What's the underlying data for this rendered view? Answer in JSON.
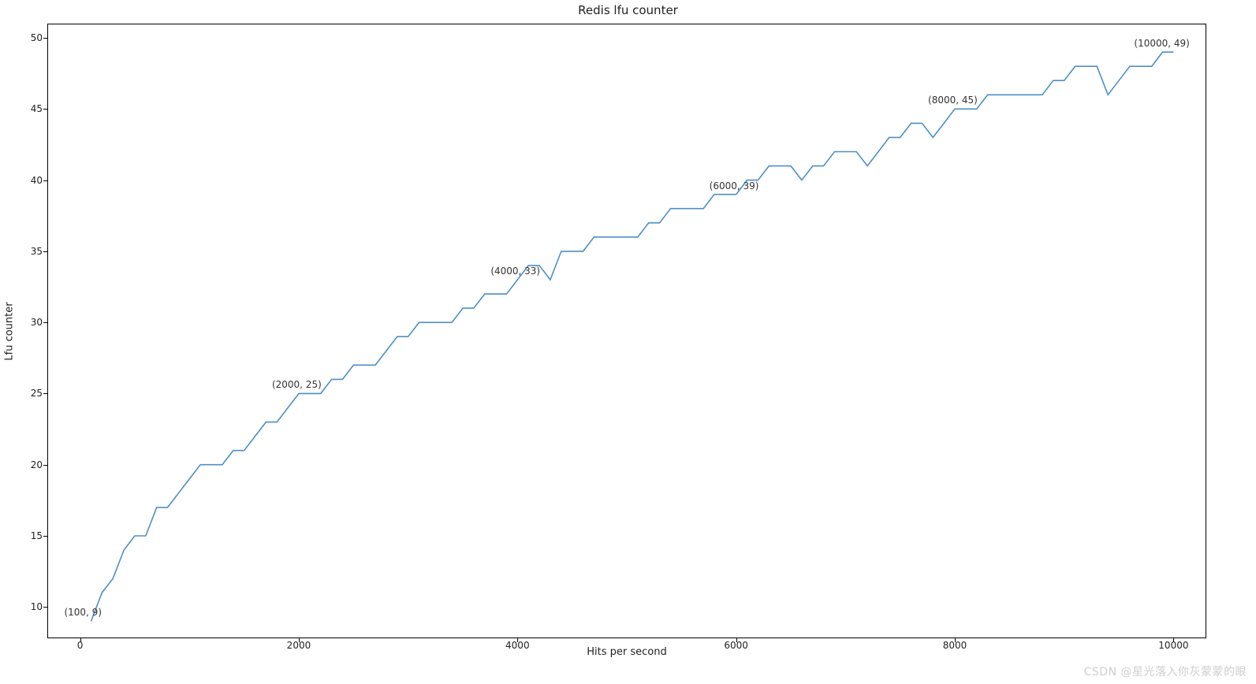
{
  "chart_data": {
    "type": "line",
    "title": "Redis lfu counter",
    "xlabel": "Hits per second",
    "ylabel": "Lfu counter",
    "xlim": [
      -300,
      10300
    ],
    "ylim": [
      7.8,
      51
    ],
    "xticks": [
      0,
      2000,
      4000,
      6000,
      8000,
      10000
    ],
    "yticks": [
      10,
      15,
      20,
      25,
      30,
      35,
      40,
      45,
      50
    ],
    "series": [
      {
        "name": "lfu",
        "color": "#4e8fc7",
        "x": [
          100,
          200,
          300,
          400,
          500,
          600,
          700,
          800,
          900,
          1000,
          1100,
          1200,
          1300,
          1400,
          1500,
          1600,
          1700,
          1800,
          1900,
          2000,
          2100,
          2200,
          2300,
          2400,
          2500,
          2600,
          2700,
          2800,
          2900,
          3000,
          3100,
          3200,
          3300,
          3400,
          3500,
          3600,
          3700,
          3800,
          3900,
          4000,
          4100,
          4200,
          4300,
          4400,
          4500,
          4600,
          4700,
          4800,
          4900,
          5000,
          5100,
          5200,
          5300,
          5400,
          5500,
          5600,
          5700,
          5800,
          5900,
          6000,
          6100,
          6200,
          6300,
          6400,
          6500,
          6600,
          6700,
          6800,
          6900,
          7000,
          7100,
          7200,
          7300,
          7400,
          7500,
          7600,
          7700,
          7800,
          7900,
          8000,
          8100,
          8200,
          8300,
          8400,
          8500,
          8600,
          8700,
          8800,
          8900,
          9000,
          9100,
          9200,
          9300,
          9400,
          9500,
          9600,
          9700,
          9800,
          9900,
          10000
        ],
        "y": [
          9,
          11,
          12,
          14,
          15,
          15,
          17,
          17,
          18,
          19,
          20,
          20,
          20,
          21,
          21,
          22,
          23,
          23,
          24,
          25,
          25,
          25,
          26,
          26,
          27,
          27,
          27,
          28,
          29,
          29,
          30,
          30,
          30,
          30,
          31,
          31,
          32,
          32,
          32,
          33,
          34,
          34,
          33,
          35,
          35,
          35,
          36,
          36,
          36,
          36,
          36,
          37,
          37,
          38,
          38,
          38,
          38,
          39,
          39,
          39,
          40,
          40,
          41,
          41,
          41,
          40,
          41,
          41,
          42,
          42,
          42,
          41,
          42,
          43,
          43,
          44,
          44,
          43,
          44,
          45,
          45,
          45,
          46,
          46,
          46,
          46,
          46,
          46,
          47,
          47,
          48,
          48,
          48,
          46,
          47,
          48,
          48,
          48,
          49,
          49
        ]
      }
    ],
    "annotations": [
      {
        "text": "(100, 9)",
        "x": 100,
        "y": 9,
        "dx": -34,
        "dy": -18
      },
      {
        "text": "(2000, 25)",
        "x": 2000,
        "y": 25,
        "dx": -34,
        "dy": -18
      },
      {
        "text": "(4000, 33)",
        "x": 4000,
        "y": 33,
        "dx": -34,
        "dy": -18
      },
      {
        "text": "(6000, 39)",
        "x": 6000,
        "y": 39,
        "dx": -34,
        "dy": -18
      },
      {
        "text": "(8000, 45)",
        "x": 8000,
        "y": 45,
        "dx": -34,
        "dy": -18
      },
      {
        "text": "(10000, 49)",
        "x": 10000,
        "y": 49,
        "dx": -50,
        "dy": -18
      }
    ]
  },
  "watermark": "CSDN @星光落入你灰蒙蒙的眼"
}
